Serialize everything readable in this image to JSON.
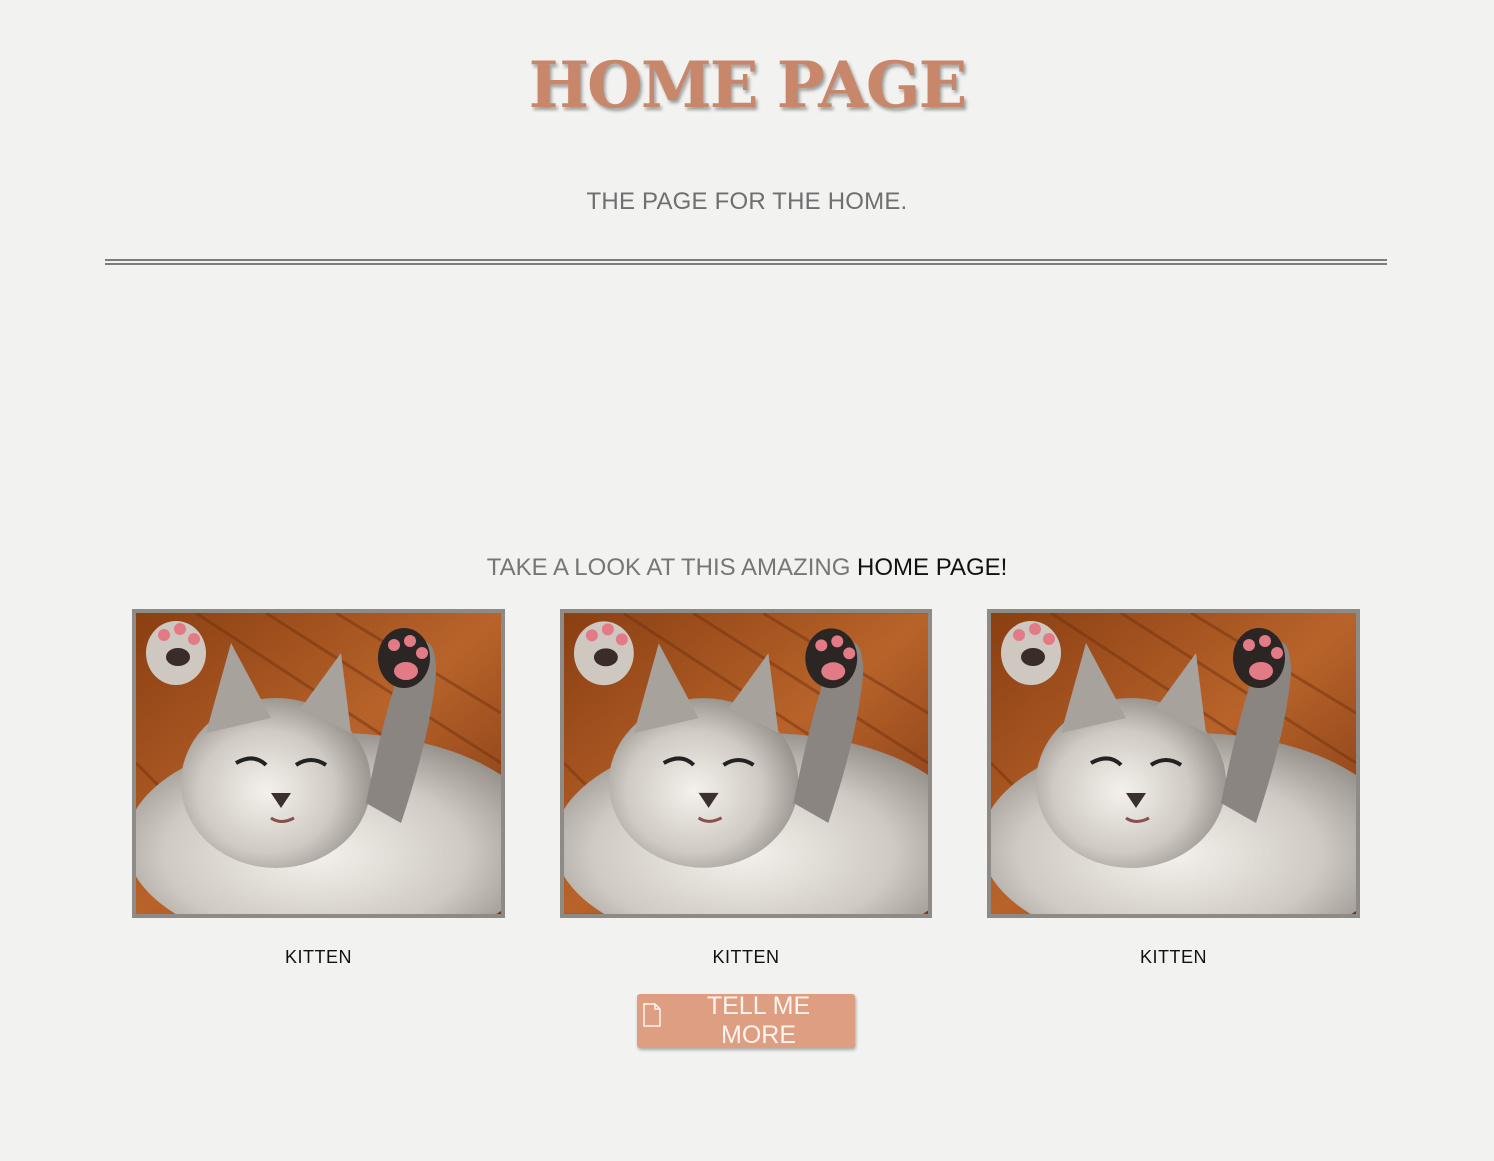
{
  "header": {
    "title": "HOME PAGE",
    "subtitle": "THE PAGE FOR THE HOME."
  },
  "intro": {
    "text_plain": "TAKE A LOOK AT THIS AMAZING ",
    "text_highlight": "HOME PAGE!"
  },
  "gallery": {
    "items": [
      {
        "caption": "KITTEN",
        "image": "kitten-photo"
      },
      {
        "caption": "KITTEN",
        "image": "kitten-photo"
      },
      {
        "caption": "KITTEN",
        "image": "kitten-photo"
      }
    ]
  },
  "cta": {
    "label": "TELL ME MORE",
    "icon": "document-icon"
  },
  "colors": {
    "background": "#f2f2f0",
    "title": "#c8876b",
    "button": "#dd9e82",
    "frame": "#8e8b86"
  }
}
